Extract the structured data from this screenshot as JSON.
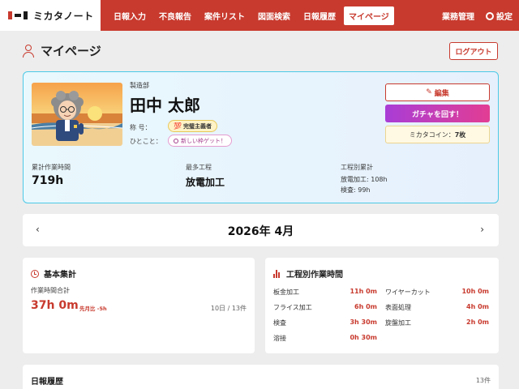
{
  "app": {
    "logo_text": "ミカタノート"
  },
  "nav": {
    "items": [
      "日報入力",
      "不良報告",
      "案件リスト",
      "図面検索",
      "日報履歴",
      "マイページ"
    ],
    "active": "マイページ",
    "business_label": "業務管理",
    "settings_label": "設定"
  },
  "page": {
    "title": "マイページ",
    "logout_label": "ログアウト"
  },
  "profile": {
    "department": "製造部",
    "name": "田中 太郎",
    "title_label": "称 号：",
    "title_badge": "完璧主義者",
    "comment_label": "ひとこと：",
    "comment_badge": "新しい枠ゲット！",
    "edit_label": "編集",
    "gacha_label": "ガチャを回す！",
    "coin_label": "ミカタコイン：",
    "coin_value": "7枚",
    "total_hours_label": "累計作業時間",
    "total_hours_value": "719h",
    "top_process_label": "最多工程",
    "top_process_value": "放電加工",
    "process_total_label": "工程別累計",
    "process_totals": [
      "放電加工: 108h",
      "検査: 99h"
    ]
  },
  "date_nav": {
    "prev": "‹",
    "next": "›",
    "label": "2026年 4月"
  },
  "basic": {
    "title": "基本集計",
    "work_time_label": "作業時間合計",
    "work_time_value": "37h 0m",
    "diff_label": "先月比 -5h",
    "days_label": "10日 / 13件"
  },
  "process": {
    "title": "工程別作業時間",
    "rows": [
      {
        "name": "板金加工",
        "value": "11h 0m"
      },
      {
        "name": "ワイヤーカット",
        "value": "10h 0m"
      },
      {
        "name": "フライス加工",
        "value": "6h 0m"
      },
      {
        "name": "表面処理",
        "value": "4h 0m"
      },
      {
        "name": "検査",
        "value": "3h 30m"
      },
      {
        "name": "旋盤加工",
        "value": "2h 0m"
      },
      {
        "name": "溶接",
        "value": "0h 30m"
      }
    ]
  },
  "history": {
    "title": "日報履歴",
    "count": "13件"
  },
  "colors": {
    "brand": "#c83a2e",
    "accent_cyan": "#4dc9e6",
    "gacha_start": "#a93dd6",
    "gacha_end": "#e23d93"
  }
}
